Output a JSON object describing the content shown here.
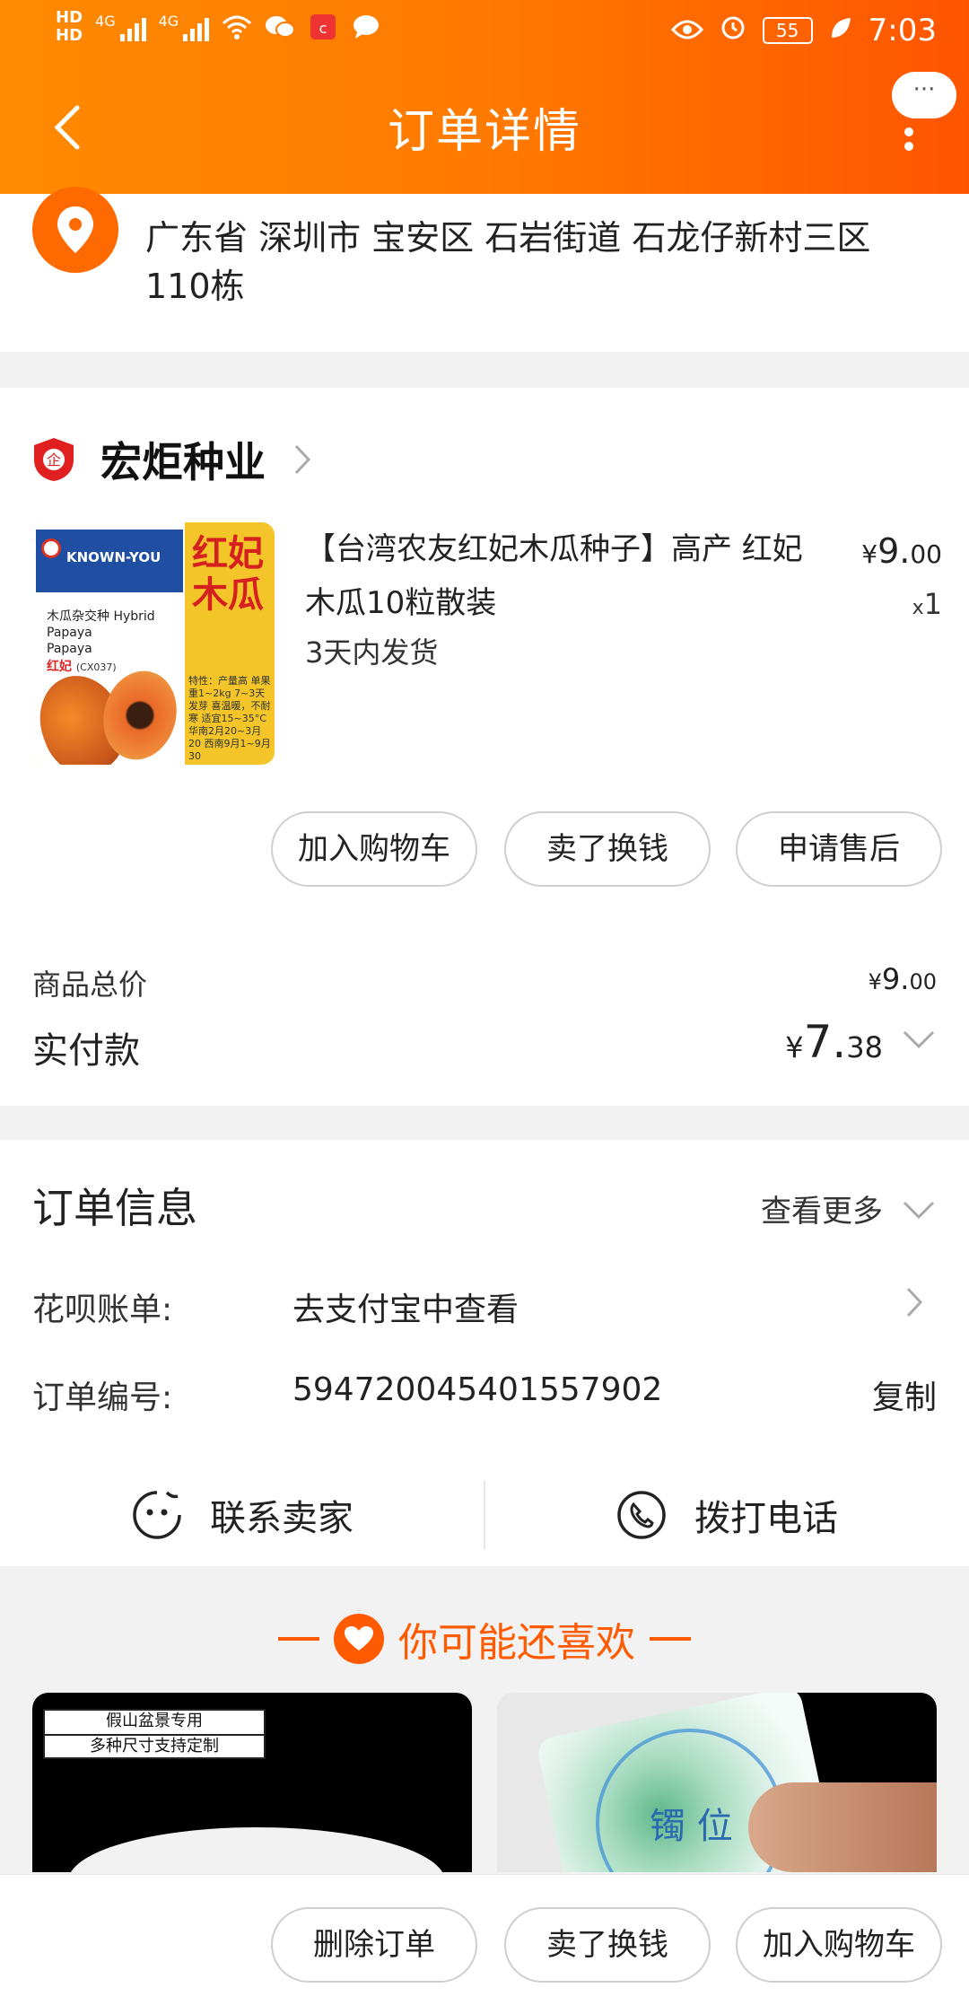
{
  "status_bar": {
    "hd1": "HD",
    "hd2": "HD",
    "net1": "4G",
    "net2": "4G",
    "battery": "55",
    "time": "7:03"
  },
  "nav": {
    "title": "订单详情",
    "more": "···"
  },
  "address": {
    "text": "广东省 深圳市 宝安区 石岩街道 石龙仔新村三区 110栋"
  },
  "shop": {
    "name": "宏炬种业"
  },
  "product": {
    "title": "【台湾农友红妃木瓜种子】高产 红妃木瓜10粒散装",
    "shipping": "3天内发货",
    "price_yen": "¥",
    "price_int": "9.",
    "price_dec": "00",
    "qty_x": "x",
    "qty": "1",
    "image_text": {
      "brand": "KNOWN-YOU",
      "kind": "木瓜杂交种 Hybrid Papaya",
      "name_en": "Papaya",
      "name_cn": "红妃",
      "code": "(CX037)",
      "cn_title": "红妃木瓜",
      "features": "特性：产量高 单果重1~2kg 7~3天发芽 喜温暖，不耐寒 适宜15~35°C 华南2月20~3月20 西南9月1~9月30"
    }
  },
  "actions": {
    "add_cart": "加入购物车",
    "sell": "卖了换钱",
    "after_sale": "申请售后"
  },
  "totals": {
    "goods_label": "商品总价",
    "goods_yen": "¥",
    "goods_int": "9.",
    "goods_dec": "00",
    "paid_label": "实付款",
    "paid_yen": "¥",
    "paid_int": "7.",
    "paid_dec": "38"
  },
  "order_info": {
    "title": "订单信息",
    "more": "查看更多",
    "huabei_label": "花呗账单:",
    "huabei_value": "去支付宝中查看",
    "order_no_label": "订单编号:",
    "order_no_value": "594720045401557902",
    "copy": "复制",
    "contact_seller": "联系卖家",
    "call_phone": "拨打电话"
  },
  "recommend": {
    "title": "你可能还喜欢",
    "card1_tag1": "假山盆景专用",
    "card1_tag2": "多种尺寸支持定制",
    "card2_text": "镯 位"
  },
  "bottom_bar": {
    "delete": "删除订单",
    "sell": "卖了换钱",
    "add_cart": "加入购物车"
  },
  "colors": {
    "brand_orange": "#ff7a00",
    "accent_orange": "#ff5a00"
  }
}
